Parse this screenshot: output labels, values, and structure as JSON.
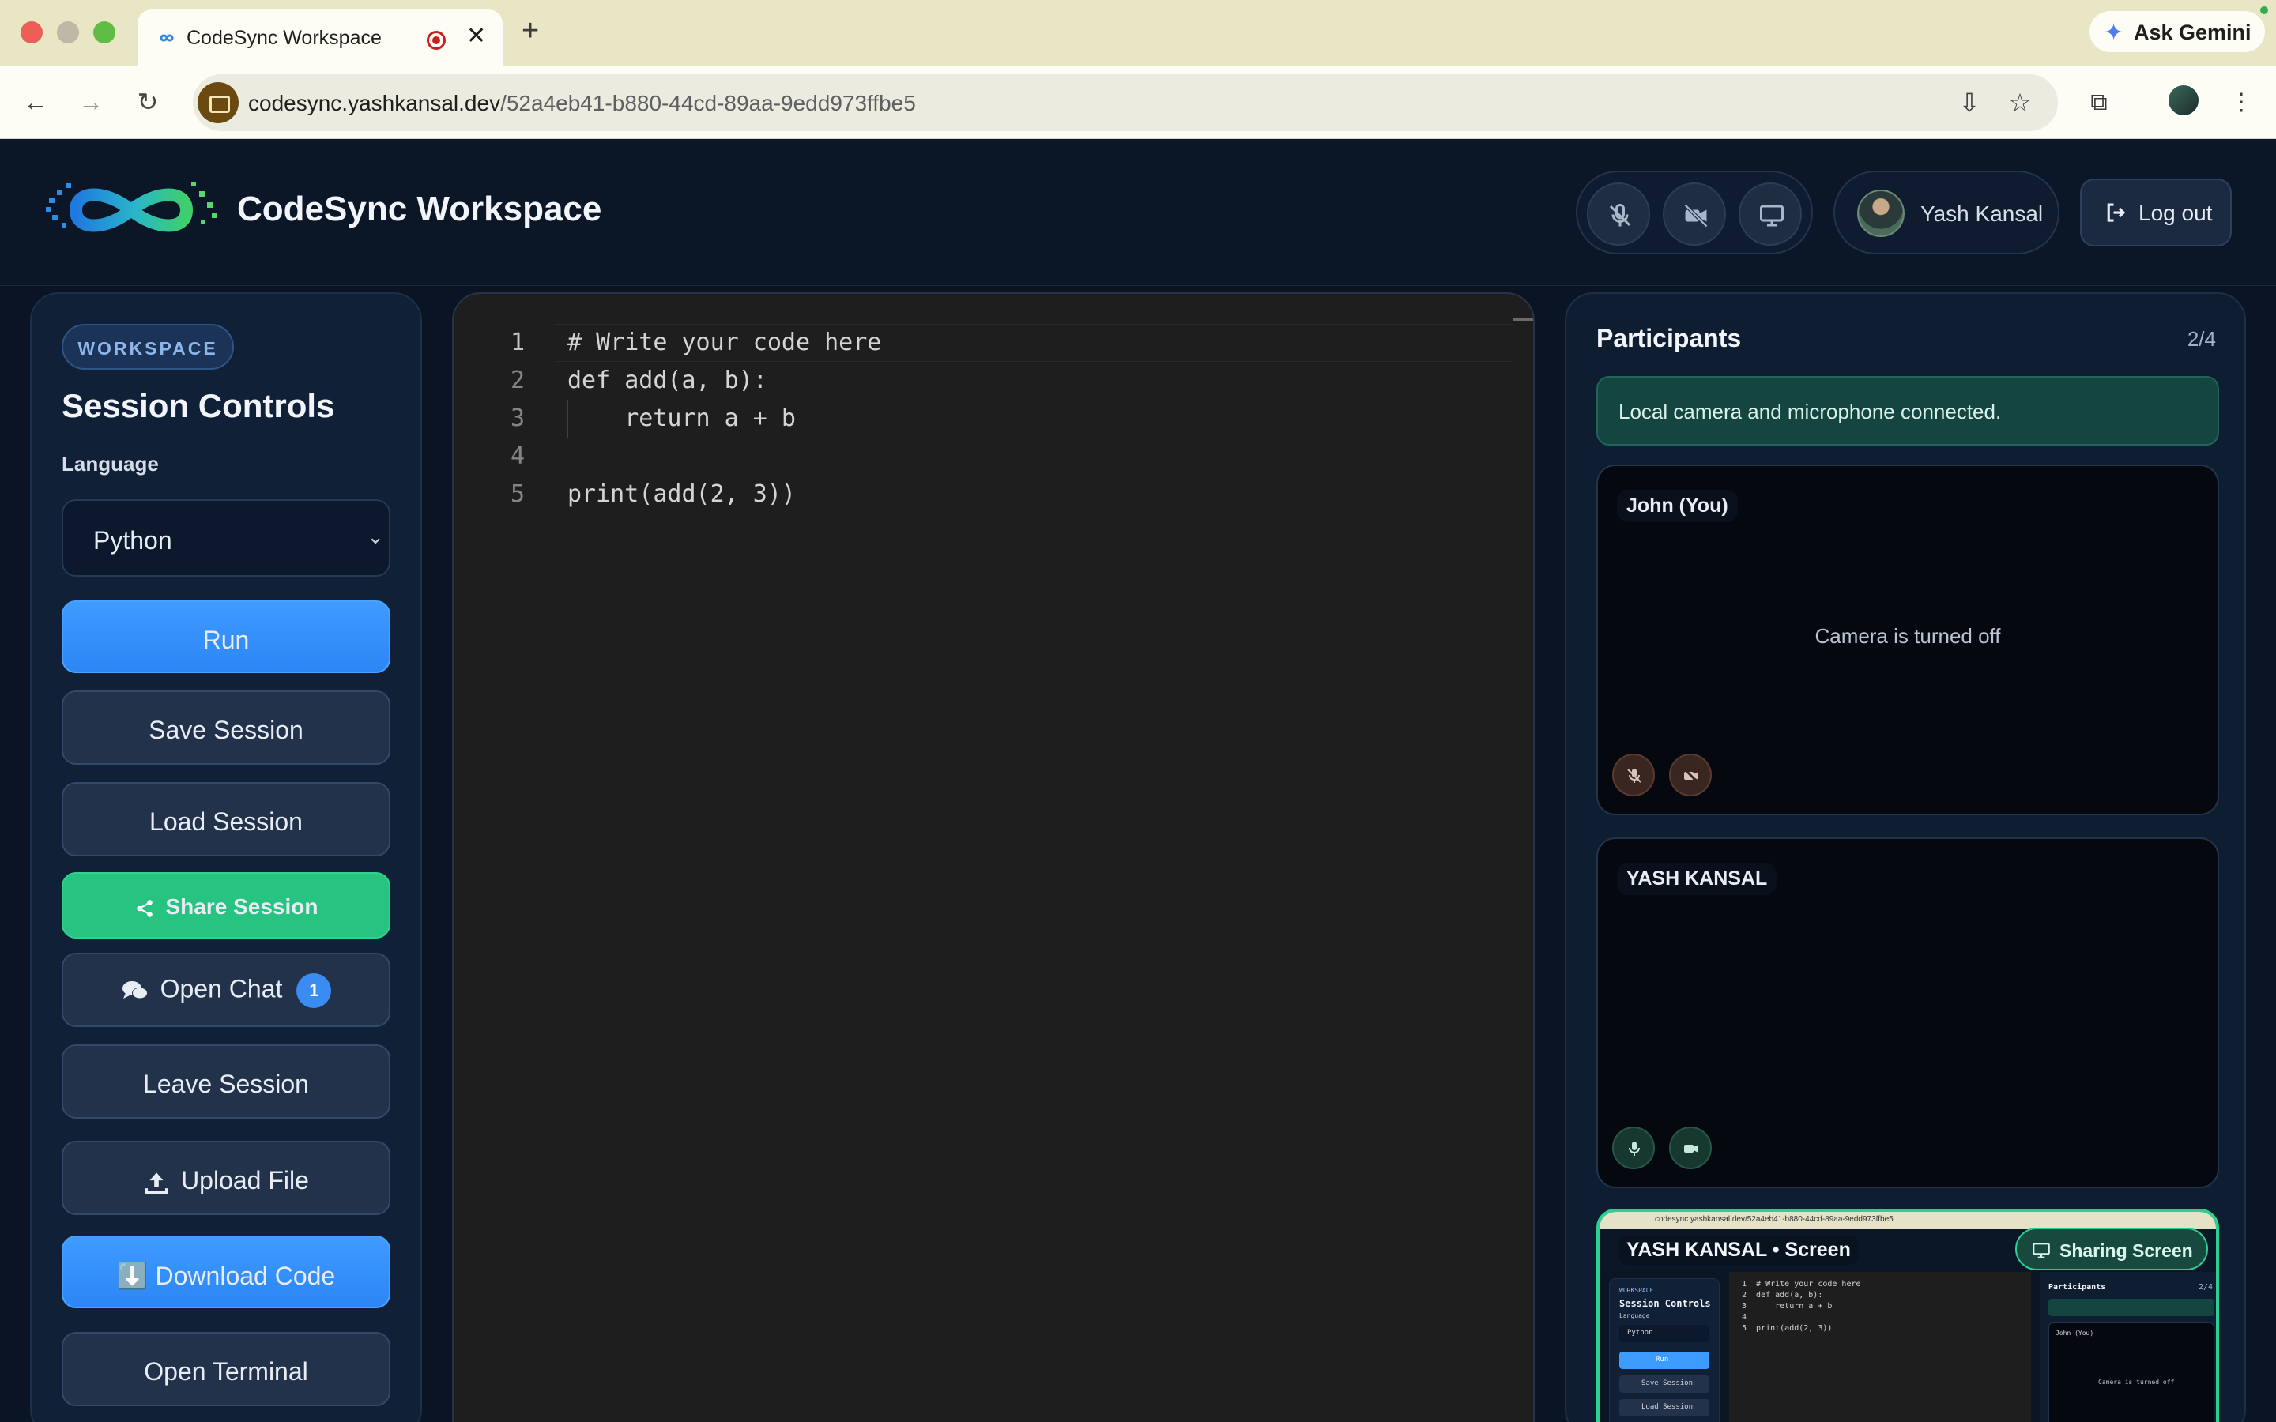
{
  "browser": {
    "tab_title": "CodeSync Workspace",
    "new_tab_icon": "plus-icon",
    "gemini_label": "Ask Gemini",
    "url_domain": "codesync.yashkansal.dev",
    "url_path": "/52a4eb41-b880-44cd-89aa-9edd973ffbe5"
  },
  "header": {
    "title": "CodeSync Workspace",
    "user_name": "Yash Kansal",
    "logout_label": "Log out"
  },
  "sidebar": {
    "badge": "WORKSPACE",
    "title": "Session Controls",
    "language_label": "Language",
    "language_value": "Python",
    "buttons": {
      "run": "Run",
      "save": "Save Session",
      "load": "Load Session",
      "share": "Share Session",
      "chat": "Open Chat",
      "chat_count": "1",
      "leave": "Leave Session",
      "upload": "Upload File",
      "download": "⬇️ Download Code",
      "terminal": "Open Terminal"
    }
  },
  "editor": {
    "lines": [
      {
        "n": "1",
        "text": "# Write your code here"
      },
      {
        "n": "2",
        "text": "def add(a, b):"
      },
      {
        "n": "3",
        "text": "    return a + b"
      },
      {
        "n": "4",
        "text": ""
      },
      {
        "n": "5",
        "text": "print(add(2, 3))"
      }
    ]
  },
  "participants": {
    "title": "Participants",
    "count": "2/4",
    "status": "Local camera and microphone connected.",
    "local": {
      "name": "John (You)",
      "camera_off": "Camera is turned off"
    },
    "remote": {
      "name": "YASH KANSAL"
    },
    "screen": {
      "name": "YASH KANSAL • Screen",
      "badge": "Sharing Screen",
      "mini_url": "codesync.yashkansal.dev/52a4eb41-b880-44cd-89aa-9edd973ffbe5",
      "mini_badge": "WORKSPACE",
      "mini_title": "Session Controls",
      "mini_language": "Language",
      "mini_lang_value": "Python",
      "mini_run": "Run",
      "mini_save": "Save Session",
      "mini_load": "Load Session",
      "mini_participants": "Participants",
      "mini_count": "2/4",
      "mini_local": "John (You)",
      "mini_camera_off": "Camera is turned off",
      "mini_code": [
        "1  # Write your code here",
        "2  def add(a, b):",
        "3      return a + b",
        "4",
        "5  print(add(2, 3))"
      ]
    }
  },
  "colors": {
    "accent_blue": "#3e9bff",
    "accent_green": "#27c380",
    "background": "#0b1424"
  }
}
